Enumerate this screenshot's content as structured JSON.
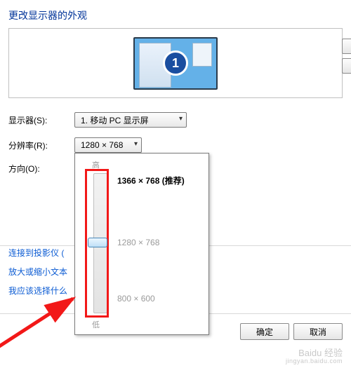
{
  "title": "更改显示器的外观",
  "monitor_badge": "1",
  "form": {
    "display_label": "显示器(S):",
    "display_value": "1. 移动 PC 显示屏",
    "resolution_label": "分辨率(R):",
    "resolution_value": "1280 × 768",
    "orientation_label": "方向(O):"
  },
  "links": {
    "projector": "连接到投影仪 (",
    "text_size": "放大或缩小文本",
    "help": "我应该选择什么"
  },
  "buttons": {
    "ok": "确定",
    "cancel": "取消"
  },
  "slider": {
    "high": "高",
    "low": "低",
    "options": [
      "1366 × 768 (推荐)",
      "1280 × 768",
      "800 × 600"
    ]
  },
  "watermark": {
    "main": "Baidu 经验",
    "sub": "jingyan.baidu.com"
  }
}
